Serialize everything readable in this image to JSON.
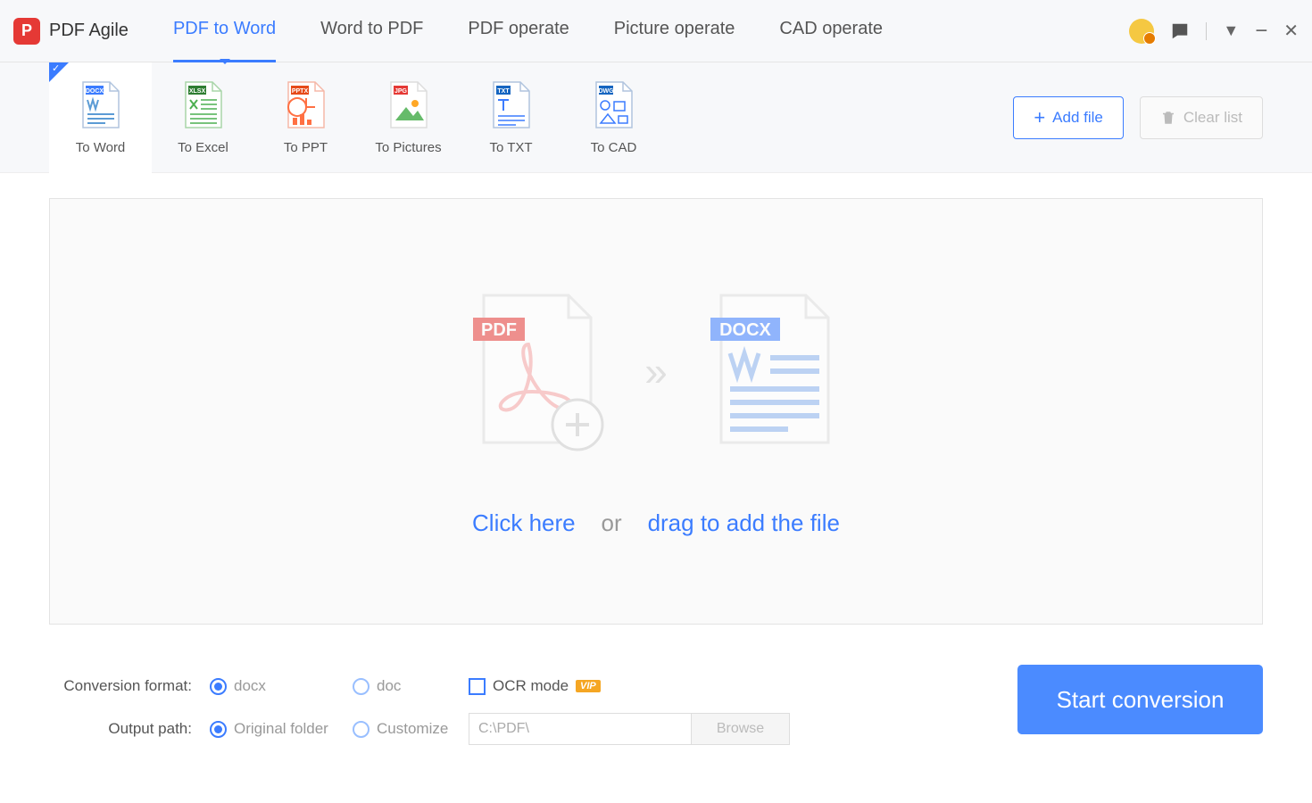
{
  "app": {
    "name": "PDF Agile"
  },
  "main_tabs": [
    "PDF to Word",
    "Word to PDF",
    "PDF operate",
    "Picture operate",
    "CAD operate"
  ],
  "active_main_tab": 0,
  "convert_types": [
    "To Word",
    "To Excel",
    "To PPT",
    "To Pictures",
    "To TXT",
    "To CAD"
  ],
  "active_convert_type": 0,
  "toolbar": {
    "add_file": "Add file",
    "clear_list": "Clear list"
  },
  "dropzone": {
    "click_here": "Click here",
    "or": "or",
    "drag": "drag to add the file"
  },
  "options": {
    "format_label": "Conversion format:",
    "format_docx": "docx",
    "format_doc": "doc",
    "ocr_label": "OCR mode",
    "vip": "VIP",
    "path_label": "Output path:",
    "path_original": "Original folder",
    "path_custom": "Customize",
    "path_value": "C:\\PDF\\",
    "browse": "Browse"
  },
  "start_button": "Start conversion"
}
